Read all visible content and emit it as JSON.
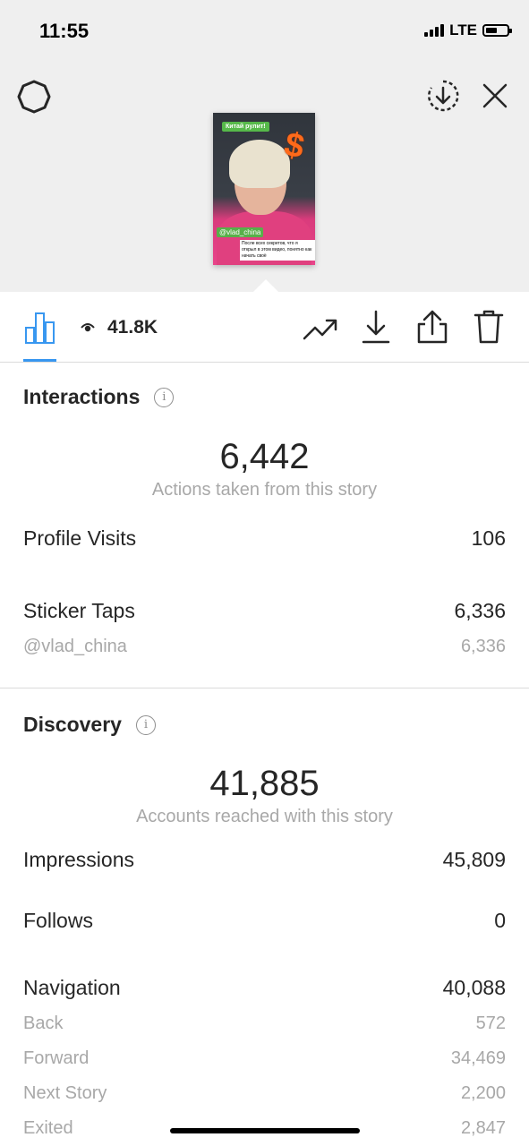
{
  "status_bar": {
    "time": "11:55",
    "network": "LTE",
    "battery_level": 0.45
  },
  "story_thumbnail": {
    "sticker_top": "Китай рулит!",
    "mention_sticker": "@vlad_china",
    "caption": "После всех секретов, что я открыл в этом видео, понятно как начать своё"
  },
  "toolbar": {
    "views": "41.8K"
  },
  "interactions": {
    "title": "Interactions",
    "total": "6,442",
    "total_label": "Actions taken from this story",
    "profile_visits_label": "Profile Visits",
    "profile_visits_value": "106",
    "sticker_taps_label": "Sticker Taps",
    "sticker_taps_value": "6,336",
    "sticker_handle": "@vlad_china",
    "sticker_handle_value": "6,336"
  },
  "discovery": {
    "title": "Discovery",
    "total": "41,885",
    "total_label": "Accounts reached with this story",
    "impressions_label": "Impressions",
    "impressions_value": "45,809",
    "follows_label": "Follows",
    "follows_value": "0",
    "navigation_label": "Navigation",
    "navigation_value": "40,088",
    "back_label": "Back",
    "back_value": "572",
    "forward_label": "Forward",
    "forward_value": "34,469",
    "next_story_label": "Next Story",
    "next_story_value": "2,200",
    "exited_label": "Exited",
    "exited_value": "2,847"
  },
  "colors": {
    "accent": "#3897f0",
    "text": "#262626",
    "muted": "#a8a8a8",
    "header_bg": "#efefef"
  }
}
